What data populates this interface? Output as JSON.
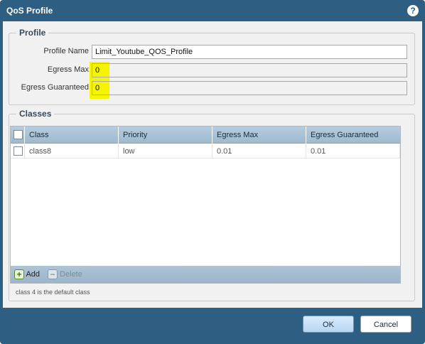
{
  "dialog": {
    "title": "QoS Profile",
    "help_icon": "?"
  },
  "profile": {
    "legend": "Profile",
    "name_label": "Profile Name",
    "name_value": "Limit_Youtube_QOS_Profile",
    "egress_max_label": "Egress Max",
    "egress_max_value": "0",
    "egress_guaranteed_label": "Egress Guaranteed",
    "egress_guaranteed_value": "0",
    "highlight_color": "#f5f500"
  },
  "classes": {
    "legend": "Classes",
    "columns": [
      "Class",
      "Priority",
      "Egress Max",
      "Egress Guaranteed"
    ],
    "rows": [
      {
        "class": "class8",
        "priority": "low",
        "egress_max": "0.01",
        "egress_guaranteed": "0.01"
      }
    ],
    "add_label": "Add",
    "delete_label": "Delete",
    "footnote": "class 4 is the default class"
  },
  "buttons": {
    "ok": "OK",
    "cancel": "Cancel"
  },
  "colors": {
    "titlebar": "#2e5f82",
    "header": "#b7cde0"
  }
}
